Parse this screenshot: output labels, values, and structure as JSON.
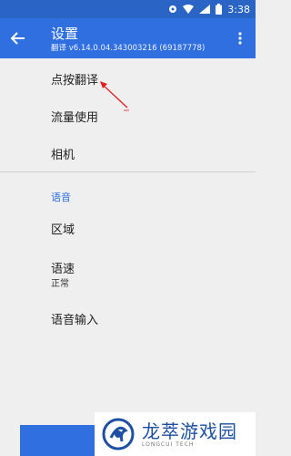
{
  "status_bar": {
    "time": "3:38"
  },
  "app_bar": {
    "title": "设置",
    "subtitle": "翻译 v6.14.0.04.343003216 (69187778)"
  },
  "settings": {
    "items": [
      {
        "label": "点按翻译"
      },
      {
        "label": "流量使用"
      },
      {
        "label": "相机"
      }
    ],
    "speech_section": {
      "title": "语音",
      "region_label": "区域",
      "speed_label": "语速",
      "speed_value": "正常",
      "voice_input_label": "语音输入"
    }
  },
  "watermark": {
    "brand_cn": "龙萃游戏园",
    "brand_en": "LONGCUI TECH"
  },
  "colors": {
    "primary": "#2f6fe0",
    "status_bar": "#2a64c5",
    "annotation_arrow": "#e02020"
  }
}
